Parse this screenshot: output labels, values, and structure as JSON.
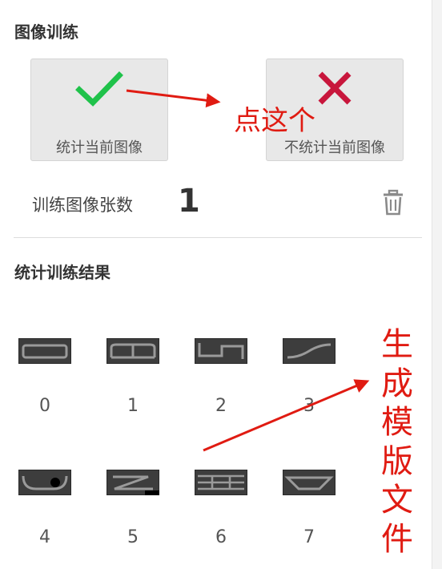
{
  "section_training": {
    "title": "图像训练",
    "count_button_label": "统计当前图像",
    "nocount_button_label": "不统计当前图像",
    "count_label": "训练图像张数",
    "count_value": "1"
  },
  "section_results": {
    "title": "统计训练结果",
    "templates": [
      {
        "label": "0"
      },
      {
        "label": "1"
      },
      {
        "label": "2"
      },
      {
        "label": "3"
      },
      {
        "label": "4"
      },
      {
        "label": "5"
      },
      {
        "label": "6"
      },
      {
        "label": "7"
      }
    ]
  },
  "annotations": {
    "click_this": "点这个",
    "generate_template_file": "生成模版文件"
  },
  "colors": {
    "accept_check": "#1fc24a",
    "reject_cross": "#c8163c",
    "annotation_red": "#e01b12"
  },
  "icons": [
    "check-icon",
    "cross-icon",
    "trash-icon"
  ]
}
